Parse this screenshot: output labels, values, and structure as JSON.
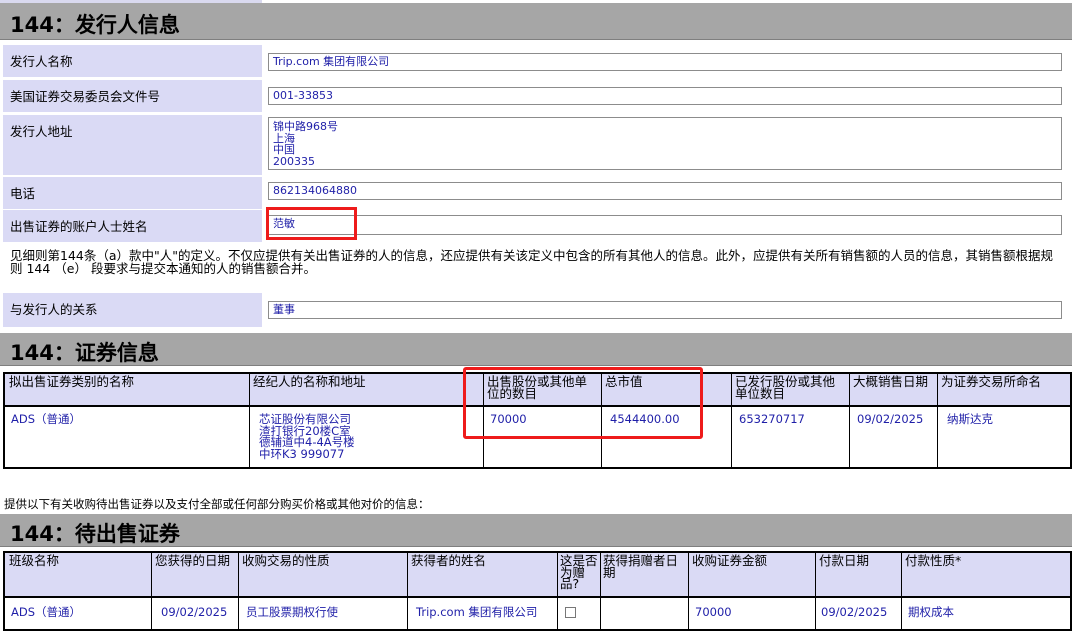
{
  "issuer_section": {
    "title": "144：发行人信息",
    "rows": [
      {
        "label": "发行人名称",
        "value": "Trip.com 集团有限公司"
      },
      {
        "label": "美国证券交易委员会文件号",
        "value": "001-33853"
      },
      {
        "label": "发行人地址",
        "value_lines": [
          "锦中路968号",
          "上海",
          "中国",
          "200335"
        ]
      },
      {
        "label": "电话",
        "value": "862134064880"
      },
      {
        "label": "出售证券的账户人士姓名",
        "value": "范敏"
      }
    ],
    "note": "见细则第144条（a）款中\"人\"的定义。不仅应提供有关出售证券的人的信息，还应提供有关该定义中包含的所有其他人的信息。此外，应提供有关所有销售额的人员的信息，其销售额根据规则 144 （e） 段要求与提交本通知的人的销售额合并。",
    "relationship": {
      "label": "与发行人的关系",
      "value": "董事"
    }
  },
  "securities_section": {
    "title": "144：证券信息",
    "headers": [
      "拟出售证券类别的名称",
      "经纪人的名称和地址",
      "出售股份或其他单位的数目",
      "总市值",
      "已发行股份或其他单位数目",
      "大概销售日期",
      "为证券交易所命名"
    ],
    "row": {
      "class_name": "ADS（普通）",
      "broker_lines": [
        "芯证股份有限公司",
        "渣打银行20楼C室",
        "德辅道中4-4A号楼",
        "中环K3 999077"
      ],
      "units_sold": "70000",
      "market_value": "4544400.00",
      "units_outstanding": "653270717",
      "sale_date": "09/02/2025",
      "exchange": "纳斯达克"
    }
  },
  "acquisition_paragraph": "提供以下有关收购待出售证券以及支付全部或任何部分购买价格或其他对价的信息：",
  "pending_section": {
    "title": "144：待出售证券",
    "headers": [
      "班级名称",
      "您获得的日期",
      "收购交易的性质",
      "获得者的姓名",
      "这是否为赠品?",
      "获得捐赠者日期",
      "收购证券金额",
      "付款日期",
      "付款性质*"
    ],
    "row": {
      "class_name": "ADS（普通）",
      "acquired_date": "09/02/2025",
      "nature": "员工股票期权行使",
      "acquirer": "Trip.com 集团有限公司",
      "is_gift": false,
      "donor_date": "",
      "amount": "70000",
      "payment_date": "09/02/2025",
      "payment_nature": "期权成本"
    }
  },
  "colors": {
    "header_bg": "#a6a6a6",
    "label_bg": "#dadaf5",
    "value_text": "#1f1fa8",
    "highlight": "#ee1b1b"
  }
}
